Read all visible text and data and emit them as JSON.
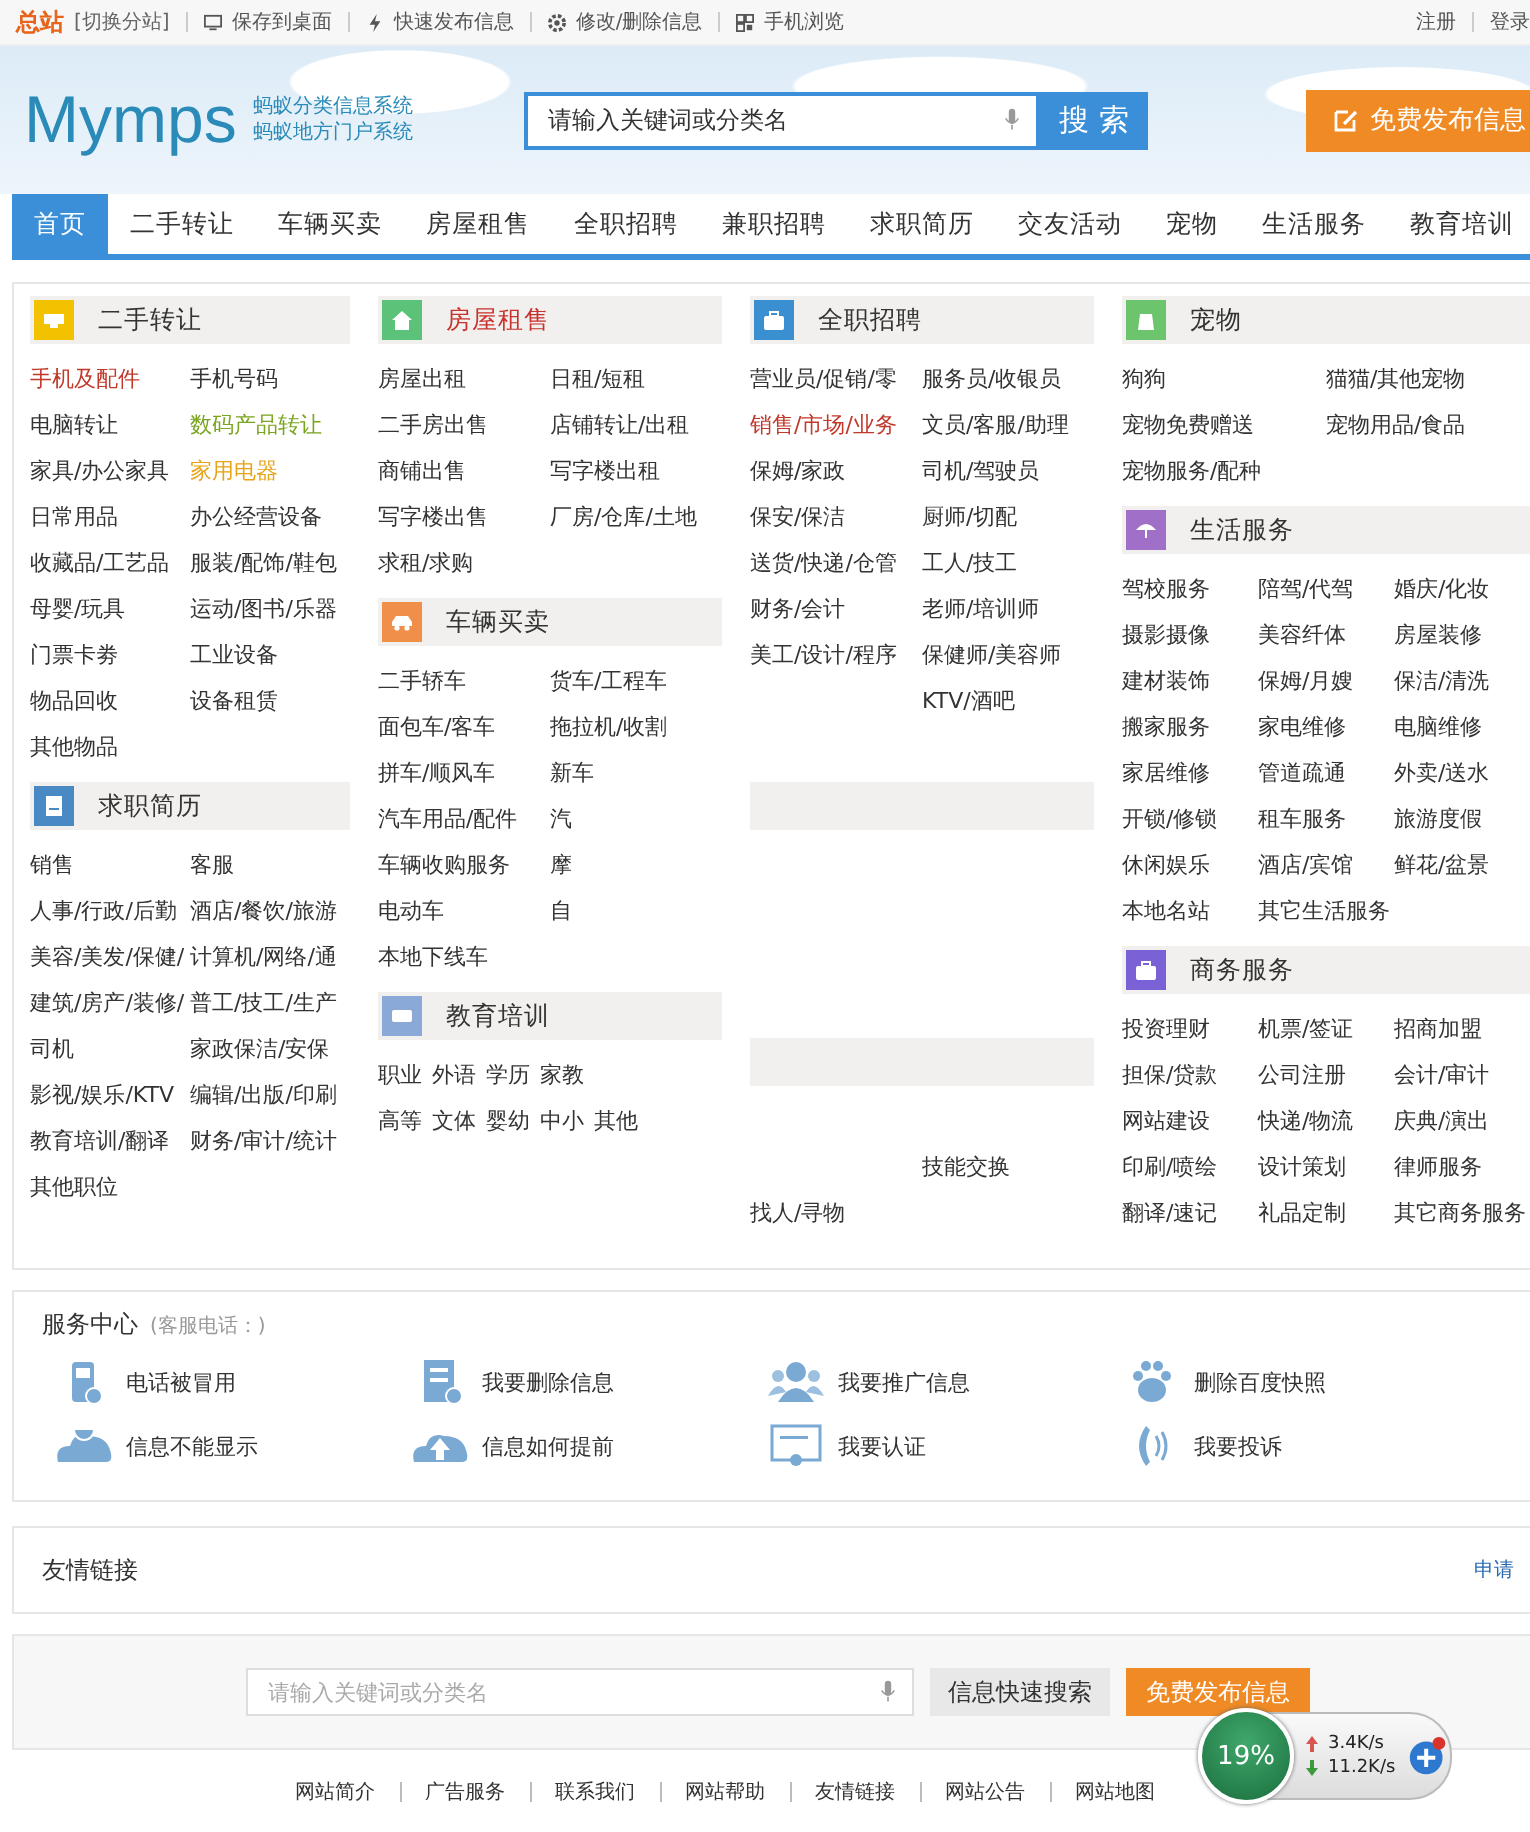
{
  "top_bar": {
    "site": "总站",
    "switch": "[切换分站]",
    "links": [
      "保存到桌面",
      "快速发布信息",
      "修改/删除信息",
      "手机浏览"
    ],
    "account": [
      "注册",
      "登录"
    ]
  },
  "header": {
    "logo": "Mymps",
    "tagline": [
      "蚂蚁分类信息系统",
      "蚂蚁地方门户系统"
    ],
    "search_placeholder": "请输入关键词或分类名",
    "search_button": "搜 索",
    "post_button": "免费发布信息"
  },
  "nav": [
    {
      "label": "首页",
      "selected": true
    },
    {
      "label": "二手转让",
      "selected": false
    },
    {
      "label": "车辆买卖",
      "selected": false
    },
    {
      "label": "房屋租售",
      "selected": false
    },
    {
      "label": "全职招聘",
      "selected": false
    },
    {
      "label": "兼职招聘",
      "selected": false
    },
    {
      "label": "求职简历",
      "selected": false
    },
    {
      "label": "交友活动",
      "selected": false
    },
    {
      "label": "宠物",
      "selected": false
    },
    {
      "label": "生活服务",
      "selected": false
    },
    {
      "label": "教育培训",
      "selected": false
    }
  ],
  "columns": [
    [
      {
        "title": "二手转让",
        "color": "#f2c200",
        "hot": false,
        "kind": "pair",
        "items": [
          {
            "text": "手机及配件",
            "color": "#c0392b"
          },
          {
            "text": "手机号码"
          },
          {
            "text": "电脑转让"
          },
          {
            "text": "数码产品转让",
            "color": "#7aa520"
          },
          {
            "text": "家具/办公家具"
          },
          {
            "text": "家用电器",
            "color": "#e8a317"
          },
          {
            "text": "日常用品"
          },
          {
            "text": "办公经营设备"
          },
          {
            "text": "收藏品/工艺品"
          },
          {
            "text": "服装/配饰/鞋包"
          },
          {
            "text": "母婴/玩具"
          },
          {
            "text": "运动/图书/乐器"
          },
          {
            "text": "门票卡劵"
          },
          {
            "text": "工业设备"
          },
          {
            "text": "物品回收"
          },
          {
            "text": "设备租赁"
          },
          {
            "text": "其他物品"
          }
        ]
      },
      {
        "title": "求职简历",
        "color": "#4a8ac4",
        "hot": false,
        "kind": "pair",
        "items": [
          {
            "text": "销售"
          },
          {
            "text": "客服"
          },
          {
            "text": "人事/行政/后勤"
          },
          {
            "text": "酒店/餐饮/旅游"
          },
          {
            "text": "美容/美发/保健/"
          },
          {
            "text": "计算机/网络/通"
          },
          {
            "text": "建筑/房产/装修/"
          },
          {
            "text": "普工/技工/生产"
          },
          {
            "text": "司机"
          },
          {
            "text": "家政保洁/安保"
          },
          {
            "text": "影视/娱乐/KTV"
          },
          {
            "text": "编辑/出版/印刷"
          },
          {
            "text": "教育培训/翻译"
          },
          {
            "text": "财务/审计/统计"
          },
          {
            "text": "其他职位"
          }
        ]
      }
    ],
    [
      {
        "title": "房屋租售",
        "color": "#5cc27a",
        "hot": true,
        "kind": "pair",
        "items": [
          {
            "text": "房屋出租"
          },
          {
            "text": "日租/短租"
          },
          {
            "text": "二手房出售"
          },
          {
            "text": "店铺转让/出租"
          },
          {
            "text": "商铺出售"
          },
          {
            "text": "写字楼出租"
          },
          {
            "text": "写字楼出售"
          },
          {
            "text": "厂房/仓库/土地"
          },
          {
            "text": "求租/求购"
          }
        ]
      },
      {
        "title": "车辆买卖",
        "color": "#ef8f4a",
        "hot": false,
        "kind": "pair",
        "items": [
          {
            "text": "二手轿车"
          },
          {
            "text": "货车/工程车"
          },
          {
            "text": "面包车/客车"
          },
          {
            "text": "拖拉机/收割"
          },
          {
            "text": "拼车/顺风车"
          },
          {
            "text": "新车"
          },
          {
            "text": "汽车用品/配件"
          },
          {
            "text": "汽"
          },
          {
            "text": "车辆收购服务"
          },
          {
            "text": "摩"
          },
          {
            "text": "电动车"
          },
          {
            "text": "自"
          },
          {
            "text": "本地下线车"
          }
        ]
      },
      {
        "title": "教育培训",
        "color": "#8aa8d8",
        "hot": false,
        "kind": "inline",
        "items": [
          {
            "text": "职业"
          },
          {
            "text": "外语"
          },
          {
            "text": "学历"
          },
          {
            "text": "家教"
          },
          {
            "text": "高等",
            "kind": "break"
          },
          {
            "text": "文体"
          },
          {
            "text": "婴幼"
          },
          {
            "text": "中小"
          },
          {
            "text": "其他"
          }
        ]
      }
    ],
    [
      {
        "title": "全职招聘",
        "color": "#3a8fd0",
        "hot": false,
        "kind": "pair",
        "items": [
          {
            "text": "营业员/促销/零"
          },
          {
            "text": "服务员/收银员"
          },
          {
            "text": "销售/市场/业务",
            "color": "#c0392b"
          },
          {
            "text": "文员/客服/助理"
          },
          {
            "text": "保姆/家政"
          },
          {
            "text": "司机/驾驶员"
          },
          {
            "text": "保安/保洁"
          },
          {
            "text": "厨师/切配"
          },
          {
            "text": "送货/快递/仓管"
          },
          {
            "text": "工人/技工"
          },
          {
            "text": "财务/会计"
          },
          {
            "text": "老师/培训师"
          },
          {
            "text": "美工/设计/程序"
          },
          {
            "text": "保健师/美容师"
          },
          {
            "kind": "hidden"
          },
          {
            "text": "KTV/酒吧"
          },
          {
            "kind": "hidden"
          },
          {
            "kind": "hidden"
          }
        ]
      },
      {
        "kind": "pair",
        "items": [
          {
            "kind": "hidden"
          },
          {
            "kind": "hidden"
          },
          {
            "kind": "hidden"
          },
          {
            "kind": "hidden"
          },
          {
            "kind": "hidden"
          },
          {
            "kind": "hidden"
          },
          {
            "kind": "hidden"
          },
          {
            "kind": "hidden"
          }
        ]
      },
      {
        "kind": "pair",
        "items": [
          {
            "kind": "hidden"
          },
          {
            "kind": "hidden"
          },
          {
            "kind": "hidden"
          },
          {
            "text": "技能交换"
          },
          {
            "text": "找人/寻物"
          }
        ]
      }
    ],
    [
      {
        "title": "宠物",
        "color": "#6cc46c",
        "hot": false,
        "kind": "pair",
        "items": [
          {
            "text": "狗狗"
          },
          {
            "text": "猫猫/其他宠物"
          },
          {
            "text": "宠物免费赠送"
          },
          {
            "text": "宠物用品/食品"
          },
          {
            "text": "宠物服务/配种"
          }
        ]
      },
      {
        "title": "生活服务",
        "color": "#a070c8",
        "hot": false,
        "kind": "triple",
        "items": [
          {
            "text": "驾校服务"
          },
          {
            "text": "陪驾/代驾"
          },
          {
            "text": "婚庆/化妆"
          },
          {
            "text": "摄影摄像"
          },
          {
            "text": "美容纤体"
          },
          {
            "text": "房屋装修"
          },
          {
            "text": "建材装饰"
          },
          {
            "text": "保姆/月嫂"
          },
          {
            "text": "保洁/清洗"
          },
          {
            "text": "搬家服务"
          },
          {
            "text": "家电维修"
          },
          {
            "text": "电脑维修"
          },
          {
            "text": "家居维修"
          },
          {
            "text": "管道疏通"
          },
          {
            "text": "外卖/送水"
          },
          {
            "text": "开锁/修锁"
          },
          {
            "text": "租车服务"
          },
          {
            "text": "旅游度假"
          },
          {
            "text": "休闲娱乐"
          },
          {
            "text": "酒店/宾馆"
          },
          {
            "text": "鲜花/盆景"
          },
          {
            "text": "本地名站"
          },
          {
            "text": "其它生活服务"
          }
        ]
      },
      {
        "title": "商务服务",
        "color": "#7a62d6",
        "hot": false,
        "kind": "triple",
        "items": [
          {
            "text": "投资理财"
          },
          {
            "text": "机票/签证"
          },
          {
            "text": "招商加盟"
          },
          {
            "text": "担保/贷款"
          },
          {
            "text": "公司注册"
          },
          {
            "text": "会计/审计"
          },
          {
            "text": "网站建设"
          },
          {
            "text": "快递/物流"
          },
          {
            "text": "庆典/演出"
          },
          {
            "text": "印刷/喷绘"
          },
          {
            "text": "设计策划"
          },
          {
            "text": "律师服务"
          },
          {
            "text": "翻译/速记"
          },
          {
            "text": "礼品定制"
          },
          {
            "text": "其它商务服务"
          }
        ]
      }
    ]
  ],
  "service_center": {
    "title": "服务中心",
    "note": "(客服电话：)",
    "items": [
      "电话被冒用",
      "我要删除信息",
      "我要推广信息",
      "删除百度快照",
      "信息不能显示",
      "信息如何提前",
      "我要认证",
      "我要投诉"
    ]
  },
  "friend_links": {
    "title": "友情链接",
    "action": "申请"
  },
  "bottom_search": {
    "placeholder": "请输入关键词或分类名",
    "search_button": "信息快速搜索",
    "post_button": "免费发布信息"
  },
  "footer_links": [
    "网站简介",
    "广告服务",
    "联系我们",
    "网站帮助",
    "友情链接",
    "网站公告",
    "网站地图"
  ],
  "net_widget": {
    "percent": "19%",
    "upload": "3.4K/s",
    "download": "11.2K/s"
  }
}
